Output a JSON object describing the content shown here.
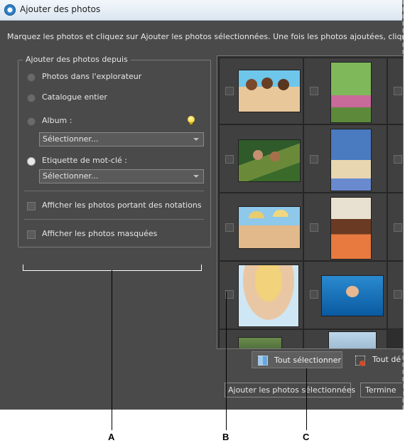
{
  "window": {
    "title": "Ajouter des photos"
  },
  "instruction": "Marquez les photos et cliquez sur Ajouter les photos sélectionnées. Une fois les photos ajoutées, cliquez s",
  "source_group": {
    "legend": "Ajouter des photos depuis",
    "options": [
      {
        "label": "Photos dans l'explorateur",
        "selected": false
      },
      {
        "label": "Catalogue entier",
        "selected": false
      },
      {
        "label": "Album :",
        "selected": false
      },
      {
        "label": "Etiquette de mot-clé :",
        "selected": true
      }
    ],
    "album_select_value": "Sélectionner...",
    "keyword_select_value": "Sélectionner...",
    "show_rated_label": "Afficher les photos portant des notations",
    "show_hidden_label": "Afficher les photos masquées"
  },
  "thumbnails": [
    {
      "name": "girls-on-beach"
    },
    {
      "name": "children-in-garden"
    },
    {
      "name": "family-in-forest"
    },
    {
      "name": "mother-with-children"
    },
    {
      "name": "couple-with-camera"
    },
    {
      "name": "woman-with-child"
    },
    {
      "name": "woman-in-sun-hat"
    },
    {
      "name": "baby-underwater"
    },
    {
      "name": "outdoor-scene"
    },
    {
      "name": "landscape"
    }
  ],
  "buttons": {
    "select_all": "Tout sélectionner",
    "deselect_all": "Tout dé",
    "add_selected": "Ajouter les photos sélectionnées",
    "done": "Termine"
  },
  "callouts": {
    "a": "A",
    "b": "B",
    "c": "C"
  },
  "colors": {
    "dialog_bg": "#4a4a4a",
    "grid_bg": "#2e2e2e",
    "titlebar": "#dbe6f1"
  }
}
